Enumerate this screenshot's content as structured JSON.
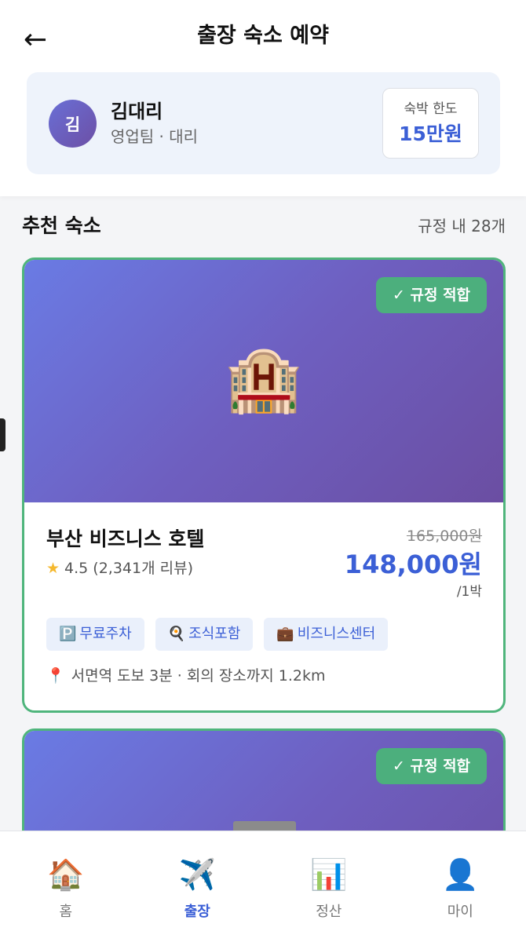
{
  "header": {
    "back_icon": "←",
    "title": "출장 숙소 예약"
  },
  "profile": {
    "avatar_initial": "김",
    "name": "김대리",
    "department": "영업팀 · 대리",
    "limit_label": "숙박 한도",
    "limit_value": "15만원"
  },
  "section": {
    "title": "추천 숙소",
    "count": "규정 내 28개"
  },
  "hotels": [
    {
      "badge": "✓ 규정 적합",
      "image_icon": "🏨",
      "name": "부산 비즈니스 호텔",
      "rating_star": "★",
      "rating": "4.5 (2,341개 리뷰)",
      "original_price": "165,000원",
      "price": "148,000원",
      "per_night": "/1박",
      "tags": [
        {
          "icon": "🅿️",
          "label": "무료주차"
        },
        {
          "icon": "🍳",
          "label": "조식포함"
        },
        {
          "icon": "💼",
          "label": "비즈니스센터"
        }
      ],
      "location_icon": "📍",
      "location": "서면역 도보 3분 · 회의 장소까지 1.2km"
    },
    {
      "badge": "✓ 규정 적합"
    }
  ],
  "nav": [
    {
      "icon": "🏠",
      "label": "홈"
    },
    {
      "icon": "✈️",
      "label": "출장"
    },
    {
      "icon": "📊",
      "label": "정산"
    },
    {
      "icon": "👤",
      "label": "마이"
    }
  ],
  "colors": {
    "accent": "#3b5fd6",
    "badge_green": "#4caf7d",
    "card_border": "#4fb57c"
  }
}
